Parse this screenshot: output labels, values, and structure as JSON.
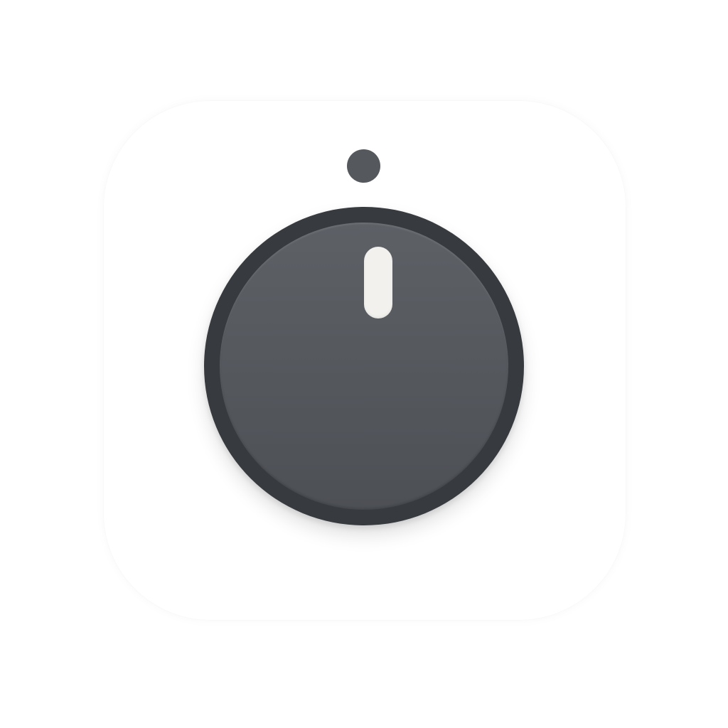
{
  "icon": {
    "name": "volume-knob-icon",
    "tile_color": "#ffffff",
    "knob_rim_color": "#373a3e",
    "knob_face_color": "#55595e",
    "pointer_color": "#f2f1ee",
    "indicator_dot_color": "#55595e"
  }
}
